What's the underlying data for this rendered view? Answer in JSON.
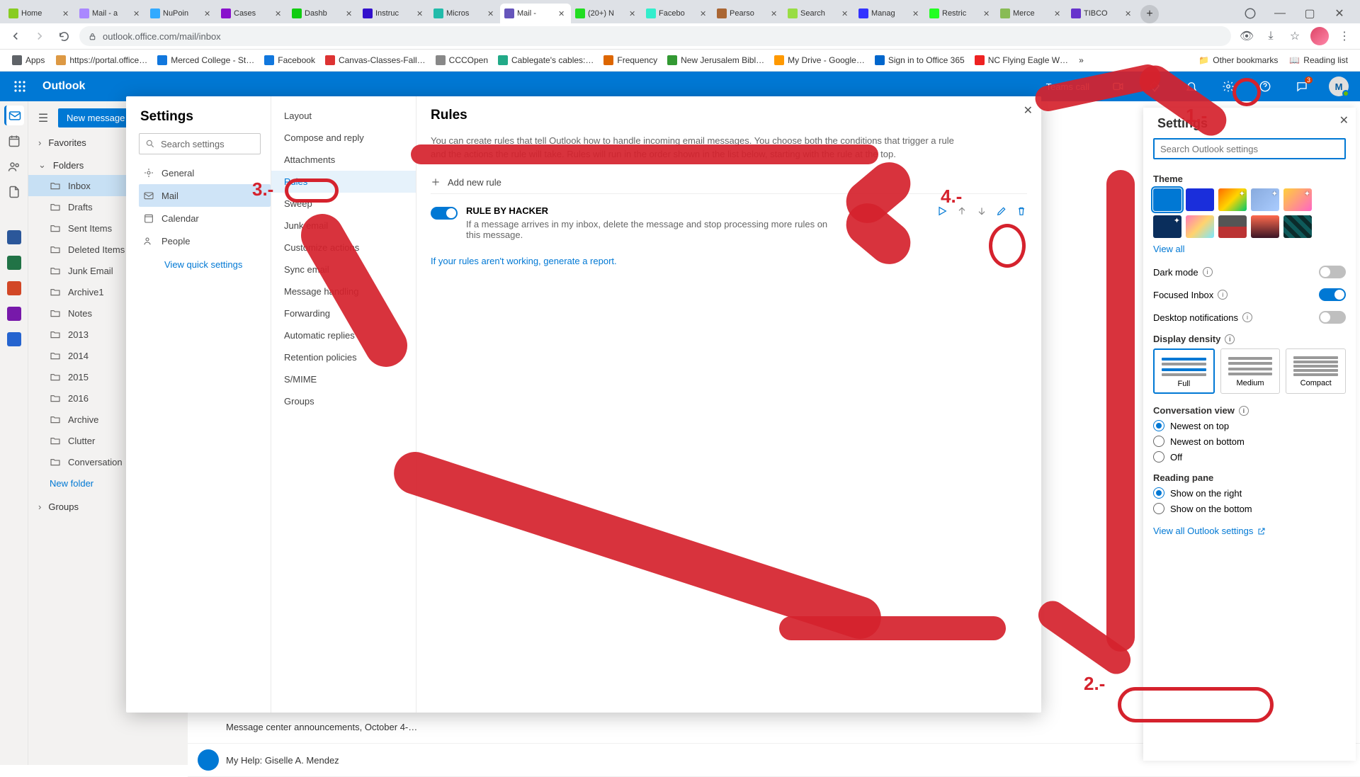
{
  "browser": {
    "tabs": [
      {
        "label": "Home"
      },
      {
        "label": "Mail - a"
      },
      {
        "label": "NuPoin"
      },
      {
        "label": "Cases"
      },
      {
        "label": "Dashb"
      },
      {
        "label": "Instruc"
      },
      {
        "label": "Micros"
      },
      {
        "label": "Mail -",
        "active": true
      },
      {
        "label": "(20+) N"
      },
      {
        "label": "Facebo"
      },
      {
        "label": "Pearso"
      },
      {
        "label": "Search"
      },
      {
        "label": "Manag"
      },
      {
        "label": "Restric"
      },
      {
        "label": "Merce"
      },
      {
        "label": "TIBCO"
      }
    ],
    "url": "outlook.office.com/mail/inbox",
    "bookmarks": [
      {
        "label": "Apps"
      },
      {
        "label": "https://portal.office…"
      },
      {
        "label": "Merced College - St…"
      },
      {
        "label": "Facebook"
      },
      {
        "label": "Canvas-Classes-Fall…"
      },
      {
        "label": "CCCOpen"
      },
      {
        "label": "Cablegate's cables:…"
      },
      {
        "label": "Frequency"
      },
      {
        "label": "New Jerusalem Bibl…"
      },
      {
        "label": "My Drive - Google…"
      },
      {
        "label": "Sign in to Office 365"
      },
      {
        "label": "NC Flying Eagle W…"
      }
    ],
    "other_bookmarks": "Other bookmarks",
    "reading_list": "Reading list"
  },
  "outlook": {
    "brand": "Outlook",
    "teams_call": "Teams call",
    "chat_badge": "3",
    "avatar_initial": "M",
    "new_message": "New message",
    "favorites_label": "Favorites",
    "folders_label": "Folders",
    "groups_label": "Groups",
    "nav_items": [
      {
        "label": "Inbox",
        "selected": true
      },
      {
        "label": "Drafts"
      },
      {
        "label": "Sent Items"
      },
      {
        "label": "Deleted Items"
      },
      {
        "label": "Junk Email"
      },
      {
        "label": "Archive1"
      },
      {
        "label": "Notes"
      },
      {
        "label": "2013"
      },
      {
        "label": "2014"
      },
      {
        "label": "2015"
      },
      {
        "label": "2016"
      },
      {
        "label": "Archive"
      },
      {
        "label": "Clutter"
      },
      {
        "label": "Conversation"
      }
    ],
    "new_folder": "New folder",
    "mail_peek": [
      {
        "subject": "Message center announcements, October 4-…"
      },
      {
        "subject": "My Help: Giselle A. Mendez"
      }
    ]
  },
  "settings_panel": {
    "title": "Settings",
    "search_placeholder": "Search Outlook settings",
    "theme_label": "Theme",
    "view_all": "View all",
    "dark_mode": "Dark mode",
    "focused_inbox": "Focused Inbox",
    "desktop_notifications": "Desktop notifications",
    "display_density": "Display density",
    "density": {
      "full": "Full",
      "medium": "Medium",
      "compact": "Compact"
    },
    "conversation_view": "Conversation view",
    "conv_newest_top": "Newest on top",
    "conv_newest_bottom": "Newest on bottom",
    "conv_off": "Off",
    "reading_pane": "Reading pane",
    "rp_right": "Show on the right",
    "rp_bottom": "Show on the bottom",
    "view_all_outlook": "View all Outlook settings"
  },
  "modal": {
    "title": "Settings",
    "search_placeholder": "Search settings",
    "categories": [
      {
        "label": "General"
      },
      {
        "label": "Mail",
        "selected": true
      },
      {
        "label": "Calendar"
      },
      {
        "label": "People"
      }
    ],
    "view_quick": "View quick settings",
    "subnav": [
      {
        "label": "Layout"
      },
      {
        "label": "Compose and reply"
      },
      {
        "label": "Attachments"
      },
      {
        "label": "Rules",
        "selected": true
      },
      {
        "label": "Sweep"
      },
      {
        "label": "Junk email"
      },
      {
        "label": "Customize actions"
      },
      {
        "label": "Sync email"
      },
      {
        "label": "Message handling"
      },
      {
        "label": "Forwarding"
      },
      {
        "label": "Automatic replies"
      },
      {
        "label": "Retention policies"
      },
      {
        "label": "S/MIME"
      },
      {
        "label": "Groups"
      }
    ],
    "rules": {
      "title": "Rules",
      "desc": "You can create rules that tell Outlook how to handle incoming email messages. You choose both the conditions that trigger a rule and the actions the rule will take. Rules will run in the order shown in the list below, starting with the rule at the top.",
      "add_new": "Add new rule",
      "rule_name": "RULE BY HACKER",
      "rule_desc": "If a message arrives in my inbox, delete the message and stop processing more rules on this message.",
      "report_link": "If your rules aren't working, generate a report."
    }
  },
  "annotations": {
    "n1": "1.-",
    "n2": "2.-",
    "n3": "3.-",
    "n4": "4.-"
  }
}
